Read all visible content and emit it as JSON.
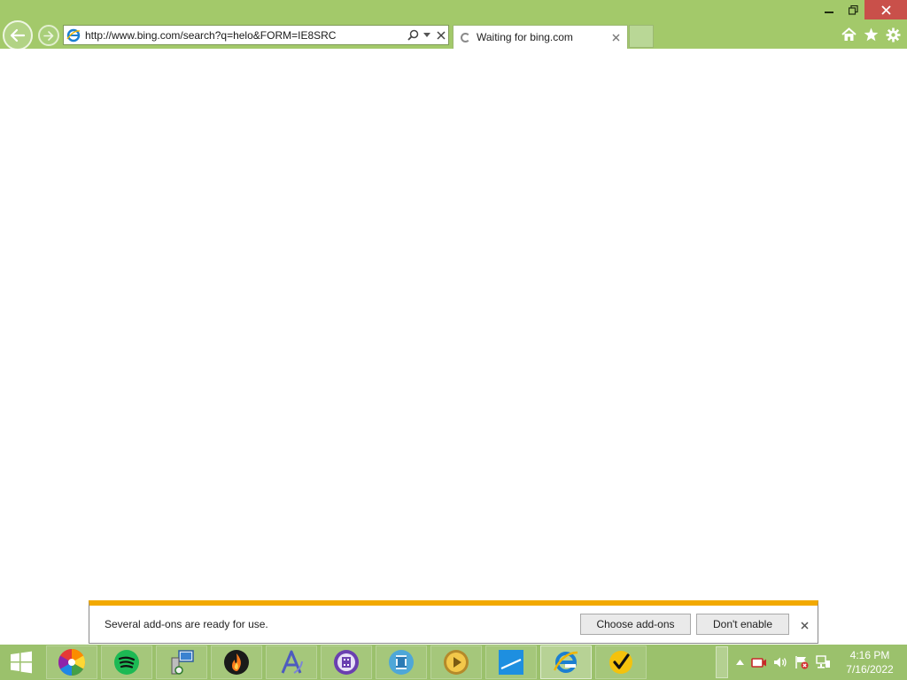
{
  "window": {
    "minimize_icon": "minimize-icon",
    "maximize_icon": "restore-icon",
    "close_icon": "close-icon",
    "close_color": "#c9504a"
  },
  "browser": {
    "address": "http://www.bing.com/search?q=helo&FORM=IE8SRC",
    "tab_title": "Waiting for bing.com",
    "accent_color": "#a3c96a"
  },
  "notification": {
    "message": "Several add-ons are ready for use.",
    "choose_label": "Choose add-ons",
    "dont_label": "Don't enable",
    "accent_color": "#f2a900"
  },
  "taskbar": {
    "apps": [
      "color-wheel-app",
      "spotify",
      "network-config",
      "firefox-like",
      "font-tool",
      "video-editor",
      "media-player-film",
      "vlc-like",
      "blue-app",
      "internet-explorer",
      "norton-check"
    ],
    "time": "4:16 PM",
    "date": "7/16/2022"
  }
}
